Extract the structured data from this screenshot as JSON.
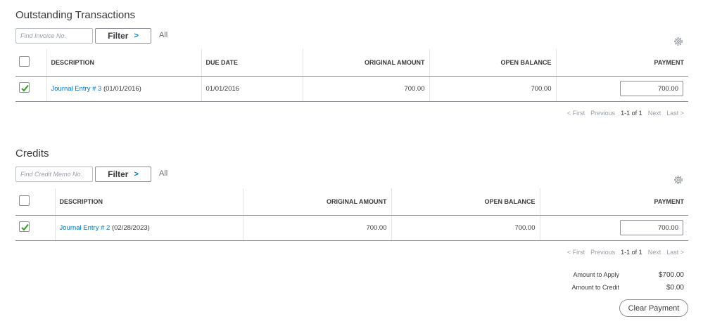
{
  "outstanding": {
    "title": "Outstanding Transactions",
    "search_placeholder": "Find Invoice No.",
    "filter_label": "Filter",
    "all_label": "All",
    "columns": [
      "DESCRIPTION",
      "DUE DATE",
      "ORIGINAL AMOUNT",
      "OPEN BALANCE",
      "PAYMENT"
    ],
    "rows": [
      {
        "checked": true,
        "description_link": "Journal Entry # 3",
        "description_date": " (01/01/2016)",
        "due_date": "01/01/2016",
        "original_amount": "700.00",
        "open_balance": "700.00",
        "payment": "700.00"
      }
    ],
    "pager": {
      "first": "< First",
      "previous": "Previous",
      "range": "1-1 of 1",
      "next": "Next",
      "last": "Last >"
    }
  },
  "credits": {
    "title": "Credits",
    "search_placeholder": "Find Credit Memo No.",
    "filter_label": "Filter",
    "all_label": "All",
    "columns": [
      "DESCRIPTION",
      "ORIGINAL AMOUNT",
      "OPEN BALANCE",
      "PAYMENT"
    ],
    "rows": [
      {
        "checked": true,
        "description_link": "Journal Entry # 2",
        "description_date": " (02/28/2023)",
        "original_amount": "700.00",
        "open_balance": "700.00",
        "payment": "700.00"
      }
    ],
    "pager": {
      "first": "< First",
      "previous": "Previous",
      "range": "1-1 of 1",
      "next": "Next",
      "last": "Last >"
    }
  },
  "summary": {
    "amount_to_apply_label": "Amount to Apply",
    "amount_to_apply": "$700.00",
    "amount_to_credit_label": "Amount to Credit",
    "amount_to_credit": "$0.00"
  },
  "clear_payment_label": "Clear Payment",
  "icons": {
    "settings": "gear-icon",
    "filter_chevron": "chevron-right-icon",
    "checkbox_mark": "checkmark-icon"
  },
  "colors": {
    "accent": "#0077c5",
    "check": "#2ca01c",
    "text": "#393a3d",
    "muted": "#9a9ea6",
    "border": "#8d9096"
  }
}
